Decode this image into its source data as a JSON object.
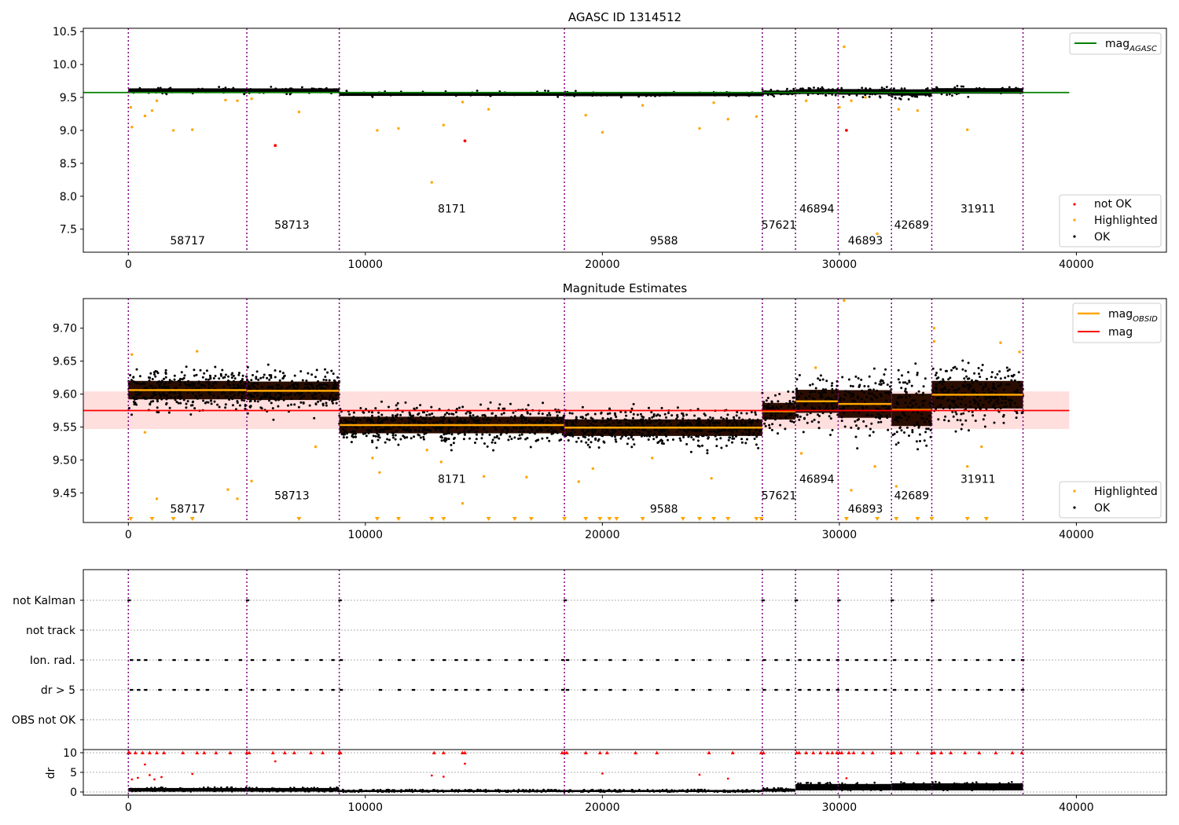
{
  "chart_data": [
    {
      "type": "scatter",
      "title": "AGASC ID 1314512",
      "xlim": [
        -1900,
        43800
      ],
      "ylim": [
        7.15,
        10.55
      ],
      "x_ticks": [
        0,
        10000,
        20000,
        30000,
        40000
      ],
      "y_ticks": [
        7.5,
        8.0,
        8.5,
        9.0,
        9.5,
        10.0,
        10.5
      ],
      "y_tick_labels": [
        "7.5",
        "8.0",
        "8.5",
        "9.0",
        "9.5",
        "10.0",
        "10.5"
      ],
      "reference_line": {
        "name": "mag",
        "subscript": "AGASC",
        "y": 9.575,
        "x": [
          -1900,
          39700
        ],
        "color": "#008000"
      },
      "obs_boundaries": [
        0,
        5000,
        8900,
        18400,
        26750,
        28150,
        29950,
        32200,
        33900,
        37750
      ],
      "obs_labels": [
        {
          "obsid": "58717",
          "x": 2500,
          "y": 7.27
        },
        {
          "obsid": "58713",
          "x": 6900,
          "y": 7.51
        },
        {
          "obsid": "8171",
          "x": 13650,
          "y": 7.75
        },
        {
          "obsid": "9588",
          "x": 22600,
          "y": 7.27
        },
        {
          "obsid": "57621",
          "x": 27450,
          "y": 7.51
        },
        {
          "obsid": "46894",
          "x": 29050,
          "y": 7.75
        },
        {
          "obsid": "46893",
          "x": 31100,
          "y": 7.27
        },
        {
          "obsid": "42689",
          "x": 33050,
          "y": 7.51
        },
        {
          "obsid": "31911",
          "x": 35850,
          "y": 7.75
        }
      ],
      "series": [
        {
          "name": "not OK",
          "color": "#ff0000",
          "points": [
            [
              6200,
              8.77
            ],
            [
              14200,
              8.84
            ],
            [
              30300,
              9.0
            ]
          ]
        },
        {
          "name": "Highlighted",
          "color": "#ffa500",
          "points": [
            [
              100,
              9.35
            ],
            [
              150,
              9.05
            ],
            [
              700,
              9.22
            ],
            [
              1000,
              9.3
            ],
            [
              1200,
              9.45
            ],
            [
              1900,
              9.0
            ],
            [
              2700,
              9.01
            ],
            [
              4100,
              9.46
            ],
            [
              4600,
              9.45
            ],
            [
              5200,
              9.48
            ],
            [
              7200,
              9.28
            ],
            [
              10500,
              9.0
            ],
            [
              11400,
              9.03
            ],
            [
              12800,
              8.21
            ],
            [
              13300,
              9.08
            ],
            [
              14100,
              9.43
            ],
            [
              15200,
              9.32
            ],
            [
              19300,
              9.23
            ],
            [
              20000,
              8.97
            ],
            [
              21700,
              9.38
            ],
            [
              24100,
              9.03
            ],
            [
              24700,
              9.42
            ],
            [
              25300,
              9.17
            ],
            [
              26500,
              9.21
            ],
            [
              28600,
              9.45
            ],
            [
              30000,
              9.35
            ],
            [
              30200,
              10.27
            ],
            [
              30500,
              9.45
            ],
            [
              31100,
              9.5
            ],
            [
              31600,
              7.43
            ],
            [
              32500,
              9.32
            ],
            [
              33300,
              9.3
            ],
            [
              35400,
              9.01
            ]
          ]
        },
        {
          "name": "OK",
          "color": "#000000"
        }
      ],
      "legend": {
        "placement": "bottom-right",
        "entries": [
          "not OK",
          "Highlighted",
          "OK"
        ]
      }
    },
    {
      "type": "scatter",
      "title": "Magnitude Estimates",
      "xlim": [
        -1900,
        43800
      ],
      "ylim": [
        9.405,
        9.745
      ],
      "x_ticks": [
        0,
        10000,
        20000,
        30000,
        40000
      ],
      "y_ticks": [
        9.45,
        9.5,
        9.55,
        9.6,
        9.65,
        9.7
      ],
      "y_tick_labels": [
        "9.45",
        "9.50",
        "9.55",
        "9.60",
        "9.65",
        "9.70"
      ],
      "mag": {
        "name": "mag",
        "y": 9.575,
        "band": [
          9.547,
          9.604
        ],
        "x": [
          -1900,
          39700
        ],
        "color": "#ff0000"
      },
      "obsid_mag": {
        "name": "mag",
        "subscript": "OBSID",
        "color": "#ffa500",
        "segments": [
          {
            "x0": 0,
            "x1": 5000,
            "y": 9.606
          },
          {
            "x0": 5000,
            "x1": 8900,
            "y": 9.605
          },
          {
            "x0": 8900,
            "x1": 18400,
            "y": 9.553
          },
          {
            "x0": 18400,
            "x1": 26750,
            "y": 9.549
          },
          {
            "x0": 26750,
            "x1": 28150,
            "y": 9.574
          },
          {
            "x0": 28150,
            "x1": 29950,
            "y": 9.589
          },
          {
            "x0": 29950,
            "x1": 32200,
            "y": 9.585
          },
          {
            "x0": 32200,
            "x1": 33900,
            "y": 9.576
          },
          {
            "x0": 33900,
            "x1": 37750,
            "y": 9.599
          }
        ]
      },
      "spread": [
        {
          "x0": 0,
          "x1": 5000,
          "center": 9.606,
          "half": 0.02
        },
        {
          "x0": 5000,
          "x1": 8900,
          "center": 9.605,
          "half": 0.02
        },
        {
          "x0": 8900,
          "x1": 18400,
          "center": 9.553,
          "half": 0.018
        },
        {
          "x0": 18400,
          "x1": 26750,
          "center": 9.549,
          "half": 0.018
        },
        {
          "x0": 26750,
          "x1": 28150,
          "center": 9.574,
          "half": 0.018
        },
        {
          "x0": 28150,
          "x1": 29950,
          "center": 9.589,
          "half": 0.025
        },
        {
          "x0": 29950,
          "x1": 32200,
          "center": 9.585,
          "half": 0.03
        },
        {
          "x0": 32200,
          "x1": 33900,
          "center": 9.576,
          "half": 0.035
        },
        {
          "x0": 33900,
          "x1": 37750,
          "center": 9.599,
          "half": 0.03
        }
      ],
      "obs_boundaries": [
        0,
        5000,
        8900,
        18400,
        26750,
        28150,
        29950,
        32200,
        33900,
        37750
      ],
      "obs_labels": [
        {
          "obsid": "58717",
          "x": 2500,
          "y": 9.42
        },
        {
          "obsid": "58713",
          "x": 6900,
          "y": 9.44
        },
        {
          "obsid": "8171",
          "x": 13650,
          "y": 9.465
        },
        {
          "obsid": "9588",
          "x": 22600,
          "y": 9.42
        },
        {
          "obsid": "57621",
          "x": 27450,
          "y": 9.44
        },
        {
          "obsid": "46894",
          "x": 29050,
          "y": 9.465
        },
        {
          "obsid": "46893",
          "x": 31100,
          "y": 9.42
        },
        {
          "obsid": "42689",
          "x": 33050,
          "y": 9.44
        },
        {
          "obsid": "31911",
          "x": 35850,
          "y": 9.465
        }
      ],
      "highlighted_points": [
        [
          150,
          9.66
        ],
        [
          700,
          9.542
        ],
        [
          1200,
          9.441
        ],
        [
          2900,
          9.665
        ],
        [
          4200,
          9.455
        ],
        [
          4600,
          9.441
        ],
        [
          5200,
          9.468
        ],
        [
          7900,
          9.52
        ],
        [
          10300,
          9.503
        ],
        [
          10600,
          9.481
        ],
        [
          12600,
          9.515
        ],
        [
          13200,
          9.497
        ],
        [
          14100,
          9.434
        ],
        [
          15000,
          9.475
        ],
        [
          16800,
          9.474
        ],
        [
          19000,
          9.467
        ],
        [
          19600,
          9.487
        ],
        [
          22100,
          9.503
        ],
        [
          24600,
          9.472
        ],
        [
          28400,
          9.51
        ],
        [
          29000,
          9.64
        ],
        [
          30200,
          9.742
        ],
        [
          30500,
          9.454
        ],
        [
          31500,
          9.49
        ],
        [
          32400,
          9.46
        ],
        [
          34000,
          9.7
        ],
        [
          34000,
          9.68
        ],
        [
          35400,
          9.49
        ],
        [
          36000,
          9.52
        ],
        [
          36800,
          9.678
        ],
        [
          37600,
          9.664
        ]
      ],
      "off_scale_markers_x": [
        100,
        1000,
        1900,
        2700,
        7200,
        10500,
        11400,
        12800,
        13300,
        15200,
        16300,
        17000,
        18400,
        19300,
        19900,
        20300,
        20600,
        21700,
        23400,
        24100,
        24700,
        25300,
        26500,
        26700,
        30300,
        31600,
        32400,
        33300,
        33900,
        35400,
        36200
      ],
      "legend": {
        "placement": "top-right and bottom-right",
        "entries": [
          "mag",
          "mag",
          "Highlighted",
          "OK"
        ]
      }
    },
    {
      "type": "scatter",
      "title": "",
      "xlim": [
        -1900,
        43800
      ],
      "categories": [
        "not Kalman",
        "not track",
        "Ion. rad.",
        "dr > 5",
        "OBS not OK"
      ],
      "obs_boundaries": [
        0,
        5000,
        8900,
        18400,
        26750,
        28150,
        29950,
        32200,
        33900,
        37750
      ],
      "flag_positions": {
        "not Kalman": [
          0,
          5000,
          8900,
          18400,
          26750,
          28150,
          29950,
          32200,
          33900
        ],
        "not track": [],
        "Ion. rad.": [
          100,
          400,
          700,
          1300,
          1900,
          2400,
          2900,
          3300,
          4100,
          4700,
          5200,
          5700,
          6300,
          6900,
          7500,
          8100,
          8600,
          8950,
          10600,
          11400,
          12000,
          12800,
          13300,
          13800,
          14200,
          14700,
          15200,
          15900,
          16500,
          17000,
          17600,
          18300,
          18500,
          19200,
          19700,
          20300,
          20900,
          21600,
          22300,
          23100,
          23800,
          24500,
          25300,
          26100,
          26800,
          27300,
          27800,
          28300,
          28700,
          29100,
          29500,
          29900,
          30300,
          30700,
          31100,
          31500,
          31900,
          32300,
          32800,
          33200,
          33700,
          34200,
          34800,
          35300,
          35800,
          36300,
          36800,
          37300,
          37700
        ],
        "dr > 5": [
          100,
          400,
          700,
          1300,
          1900,
          2400,
          2900,
          3300,
          4100,
          4700,
          5200,
          5700,
          6300,
          6900,
          7500,
          8100,
          8600,
          8950,
          10600,
          11400,
          12000,
          12800,
          13300,
          13800,
          14200,
          14700,
          15200,
          15900,
          16500,
          17000,
          17600,
          18300,
          18500,
          19200,
          19700,
          20300,
          20900,
          21600,
          22300,
          23100,
          23800,
          24500,
          25300,
          26100,
          26800,
          27300,
          27800,
          28300,
          28700,
          29100,
          29500,
          29900,
          30300,
          30700,
          31100,
          31500,
          31900,
          32300,
          32800,
          33200,
          33700,
          34200,
          34800,
          35300,
          35800,
          36300,
          36800,
          37300,
          37700
        ],
        "OBS not OK": []
      }
    },
    {
      "type": "scatter",
      "ylabel": "dr",
      "xlim": [
        -1900,
        43800
      ],
      "ylim": [
        -0.8,
        10.8
      ],
      "x_ticks": [
        0,
        10000,
        20000,
        30000,
        40000
      ],
      "y_ticks": [
        0,
        5,
        10
      ],
      "obs_boundaries": [
        0,
        5000,
        8900,
        18400,
        26750,
        28150,
        29950,
        32200,
        33900,
        37750
      ],
      "dr_bands": [
        {
          "x0": 0,
          "x1": 8900,
          "y0": 0.1,
          "y1": 1.2
        },
        {
          "x0": 8900,
          "x1": 26750,
          "y0": 0.0,
          "y1": 0.6
        },
        {
          "x0": 26750,
          "x1": 28150,
          "y0": 0.1,
          "y1": 1.0
        },
        {
          "x0": 28150,
          "x1": 32200,
          "y0": 0.4,
          "y1": 2.4
        },
        {
          "x0": 32200,
          "x1": 37750,
          "y0": 0.4,
          "y1": 2.6
        }
      ],
      "outliers_red": [
        [
          150,
          3.2
        ],
        [
          400,
          3.6
        ],
        [
          700,
          7.0
        ],
        [
          900,
          4.3
        ],
        [
          1100,
          3.2
        ],
        [
          1400,
          3.8
        ],
        [
          2700,
          4.6
        ],
        [
          6200,
          7.8
        ],
        [
          12800,
          4.2
        ],
        [
          13300,
          3.9
        ],
        [
          14200,
          7.2
        ],
        [
          20000,
          4.7
        ],
        [
          24100,
          4.4
        ],
        [
          25300,
          3.4
        ],
        [
          30300,
          3.5
        ]
      ],
      "saturated_x": [
        0,
        50,
        300,
        600,
        900,
        1200,
        1500,
        2300,
        2900,
        3200,
        3700,
        4300,
        5000,
        5100,
        6100,
        6600,
        7000,
        7700,
        8200,
        8900,
        8950,
        12900,
        13300,
        14100,
        14200,
        18300,
        18400,
        18500,
        19300,
        19900,
        20200,
        21400,
        22300,
        24500,
        25500,
        26700,
        26800,
        28200,
        28300,
        28600,
        28900,
        29200,
        29500,
        29700,
        29900,
        30000,
        30100,
        30400,
        30600,
        31000,
        31400,
        32200,
        32300,
        32600,
        33300,
        33900,
        34000,
        34300,
        34700,
        35300,
        35900,
        36600,
        37300,
        37700
      ]
    }
  ]
}
